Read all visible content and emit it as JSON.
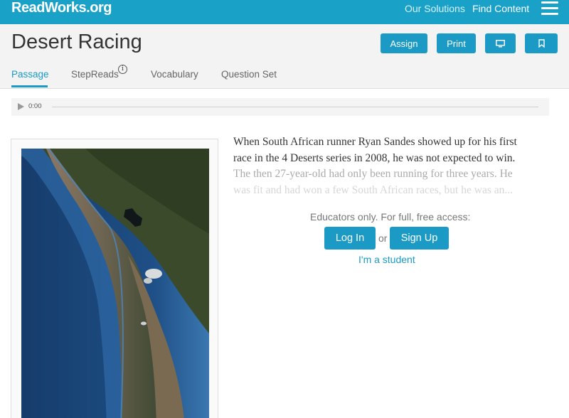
{
  "nav": {
    "logo": "ReadWorks.org",
    "links": [
      "Our Solutions",
      "Find Content"
    ],
    "menu_icon": "hamburger-icon"
  },
  "header": {
    "title": "Desert Racing",
    "buttons": {
      "assign": "Assign",
      "print": "Print",
      "present_icon": "monitor-icon",
      "bookmark_icon": "bookmark-icon"
    },
    "tabs": [
      "Passage",
      "StepReads",
      "Vocabulary",
      "Question Set"
    ],
    "active_tab": "Passage",
    "info_icon": "i"
  },
  "audio": {
    "play_icon": "play-icon",
    "time": "0:00"
  },
  "passage": {
    "lines": [
      "When South African runner Ryan Sandes showed up for his first",
      "race in the 4 Deserts series in 2008, he was not expected to win.",
      "The then 27-year-old had only been running for three years. He",
      "was fit and had won a few South African races, but he was an..."
    ]
  },
  "access": {
    "note": "Educators only. For full, free access:",
    "login": "Log In",
    "or": "or",
    "signup": "Sign Up",
    "student": "I'm a student"
  },
  "colors": {
    "brand": "#1aa1c8",
    "button": "#1a9ac4"
  }
}
